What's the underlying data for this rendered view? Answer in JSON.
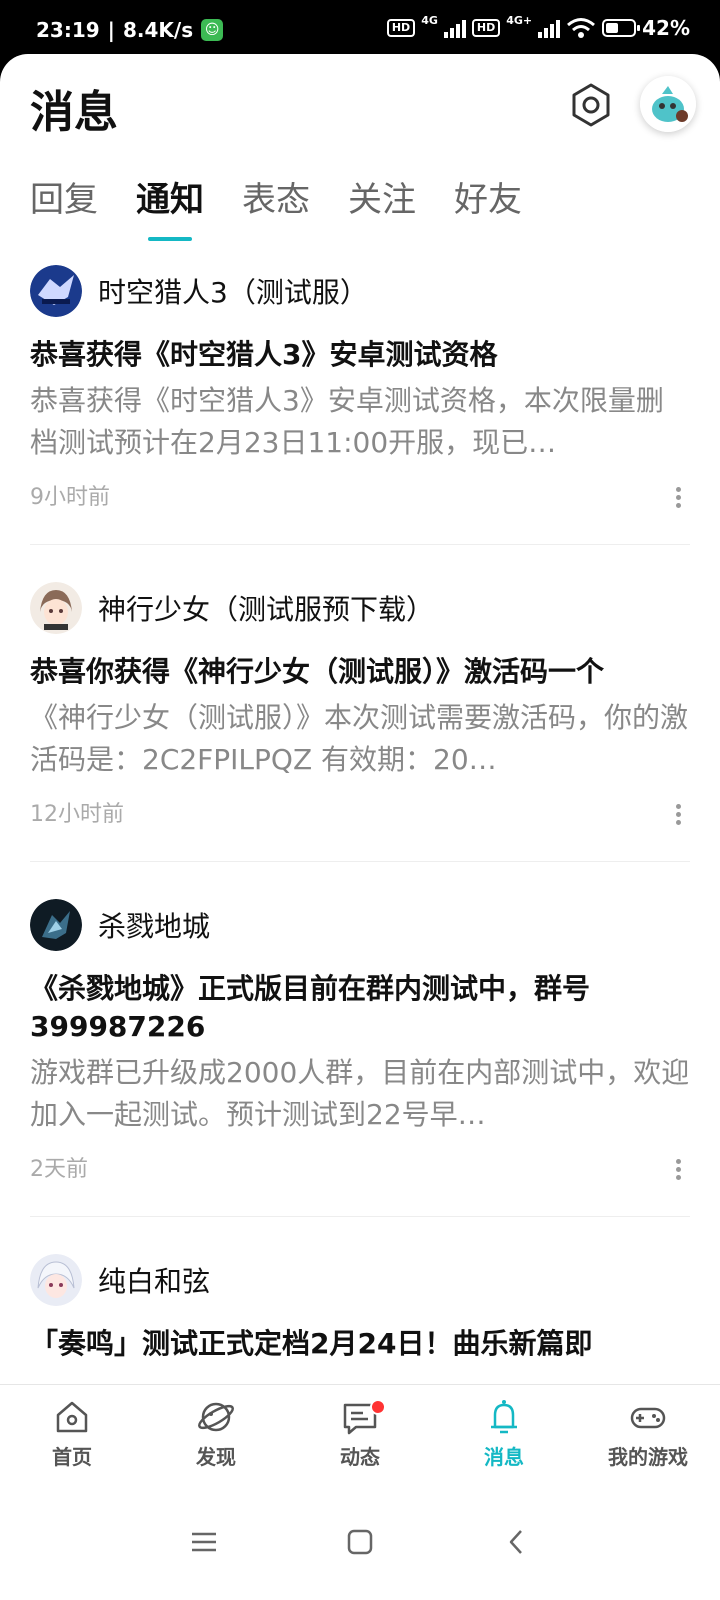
{
  "status_bar": {
    "time": "23:19",
    "speed": "8.4K/s",
    "hd1": "HD",
    "net1": "4G",
    "hd2": "HD",
    "net2": "4G+",
    "battery": "42%"
  },
  "header": {
    "title": "消息"
  },
  "tabs": [
    {
      "label": "回复"
    },
    {
      "label": "通知",
      "active": true
    },
    {
      "label": "表态"
    },
    {
      "label": "关注"
    },
    {
      "label": "好友"
    }
  ],
  "notifications": [
    {
      "game": "时空猎人3（测试服）",
      "title": "恭喜获得《时空猎人3》安卓测试资格",
      "body": "恭喜获得《时空猎人3》安卓测试资格，本次限量删档测试预计在2月23日11:00开服，现已…",
      "time": "9小时前"
    },
    {
      "game": "神行少女（测试服预下载）",
      "title": "恭喜你获得《神行少女（测试服）》激活码一个",
      "body": "《神行少女（测试服）》本次测试需要激活码，你的激活码是：2C2FPILPQZ 有效期：20…",
      "time": "12小时前"
    },
    {
      "game": "杀戮地城",
      "title": "《杀戮地城》正式版目前在群内测试中，群号399987226",
      "body": "游戏群已升级成2000人群，目前在内部测试中，欢迎加入一起测试。预计测试到22号早…",
      "time": "2天前"
    },
    {
      "game": "纯白和弦",
      "title": "「奏鸣」测试正式定档2月24日！曲乐新篇即",
      "body": "",
      "time": ""
    }
  ],
  "bottom_nav": [
    {
      "label": "首页",
      "icon": "home-icon"
    },
    {
      "label": "发现",
      "icon": "discover-icon"
    },
    {
      "label": "动态",
      "icon": "moments-icon",
      "badge": true
    },
    {
      "label": "消息",
      "icon": "bell-icon",
      "active": true
    },
    {
      "label": "我的游戏",
      "icon": "gamepad-icon"
    }
  ],
  "colors": {
    "accent": "#14b8c4",
    "badge": "#ff3333"
  }
}
